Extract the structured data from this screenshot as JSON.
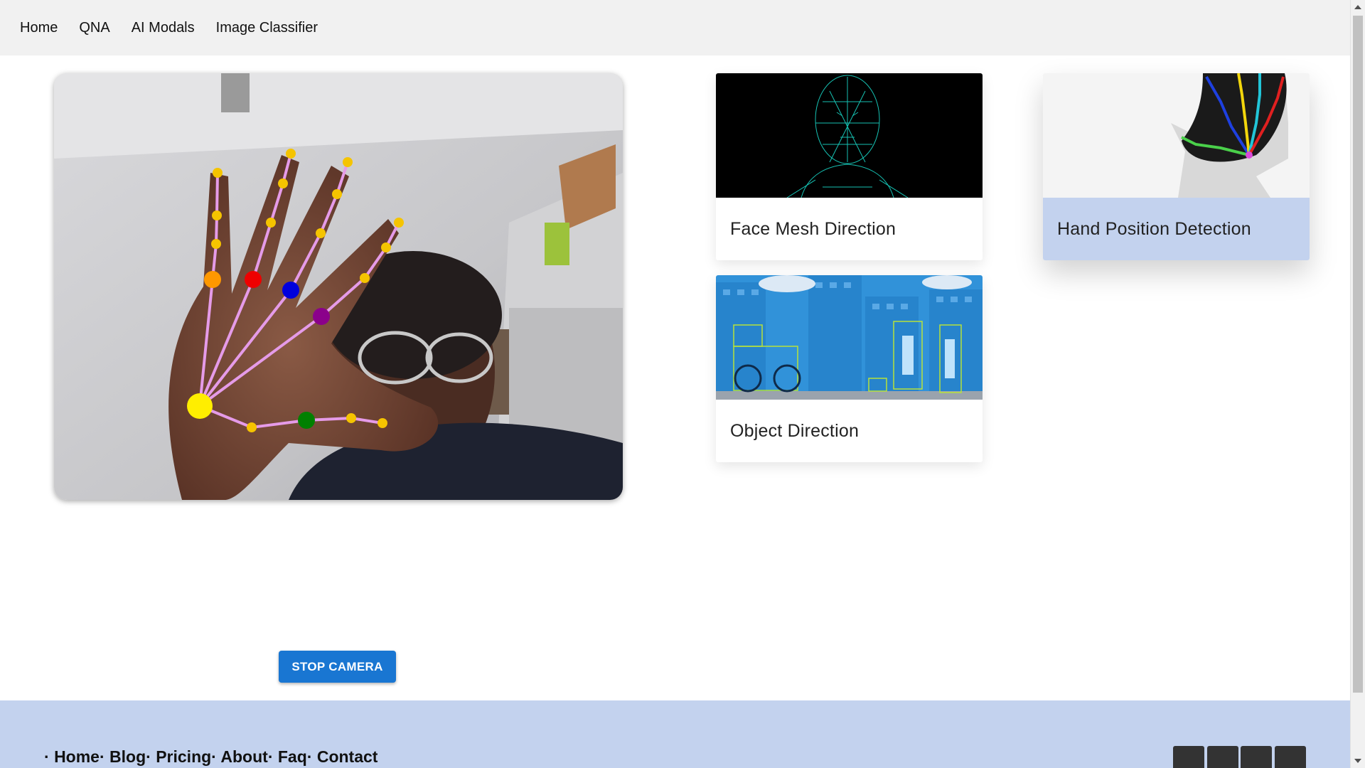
{
  "nav": {
    "items": [
      "Home",
      "QNA",
      "AI Modals",
      "Image Classifier"
    ]
  },
  "cards": [
    {
      "title": "Face Mesh Direction",
      "icon": "face-mesh-thumbnail"
    },
    {
      "title": "Hand Position Detection",
      "icon": "hand-landmarks-thumbnail",
      "selected": true
    },
    {
      "title": "Object Direction",
      "icon": "object-detection-thumbnail"
    }
  ],
  "camera": {
    "icon": "webcam-feed-hand-landmarks"
  },
  "stop_button": {
    "label": "STOP CAMERA"
  },
  "footer": {
    "links": [
      "Home",
      "Blog",
      "Pricing",
      "About",
      "Faq",
      "Contact"
    ],
    "separator": "·"
  },
  "colors": {
    "nav_bg": "#f1f1f1",
    "button_blue": "#1976d2",
    "footer_bg": "#c3d2ee",
    "selected_card_bg": "#c3d2ee"
  }
}
